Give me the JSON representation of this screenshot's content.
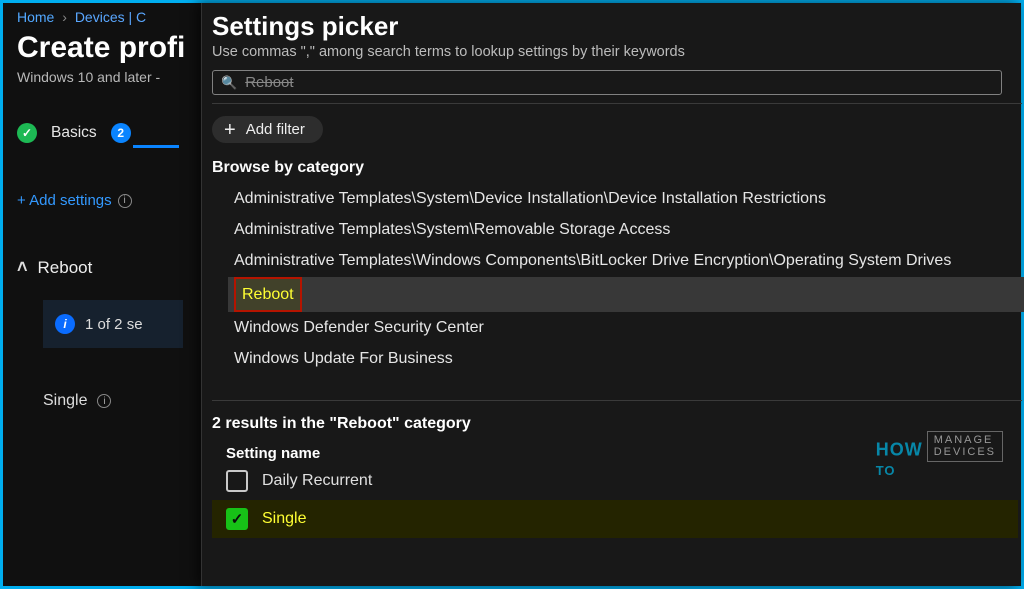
{
  "breadcrumb": {
    "home": "Home",
    "devices": "Devices | C",
    "sep": "›"
  },
  "page": {
    "title": "Create profi",
    "subtitle": "Windows 10 and later -"
  },
  "wizard": {
    "step1_label": "Basics",
    "step2_number": "2"
  },
  "add_settings": "+ Add settings",
  "left_group": {
    "title": "Reboot",
    "card_text": "1 of 2 se",
    "single_label": "Single"
  },
  "flyout": {
    "title": "Settings picker",
    "subtitle": "Use commas \",\" among search terms to lookup settings by their keywords",
    "search_value": "Reboot",
    "add_filter": "Add filter",
    "browse_label": "Browse by category",
    "categories": [
      "Administrative Templates\\System\\Device Installation\\Device Installation Restrictions",
      "Administrative Templates\\System\\Removable Storage Access",
      "Administrative Templates\\Windows Components\\BitLocker Drive Encryption\\Operating System Drives",
      "Reboot",
      "Windows Defender Security Center",
      "Windows Update For Business"
    ],
    "selected_category_index": 3,
    "results_heading": "2 results in the \"Reboot\" category",
    "column_header": "Setting name",
    "results": [
      {
        "label": "Daily Recurrent",
        "checked": false
      },
      {
        "label": "Single",
        "checked": true
      }
    ]
  },
  "watermark": {
    "how": "HOW",
    "to": "TO",
    "line1": "MANAGE",
    "line2": "DEVICES"
  }
}
